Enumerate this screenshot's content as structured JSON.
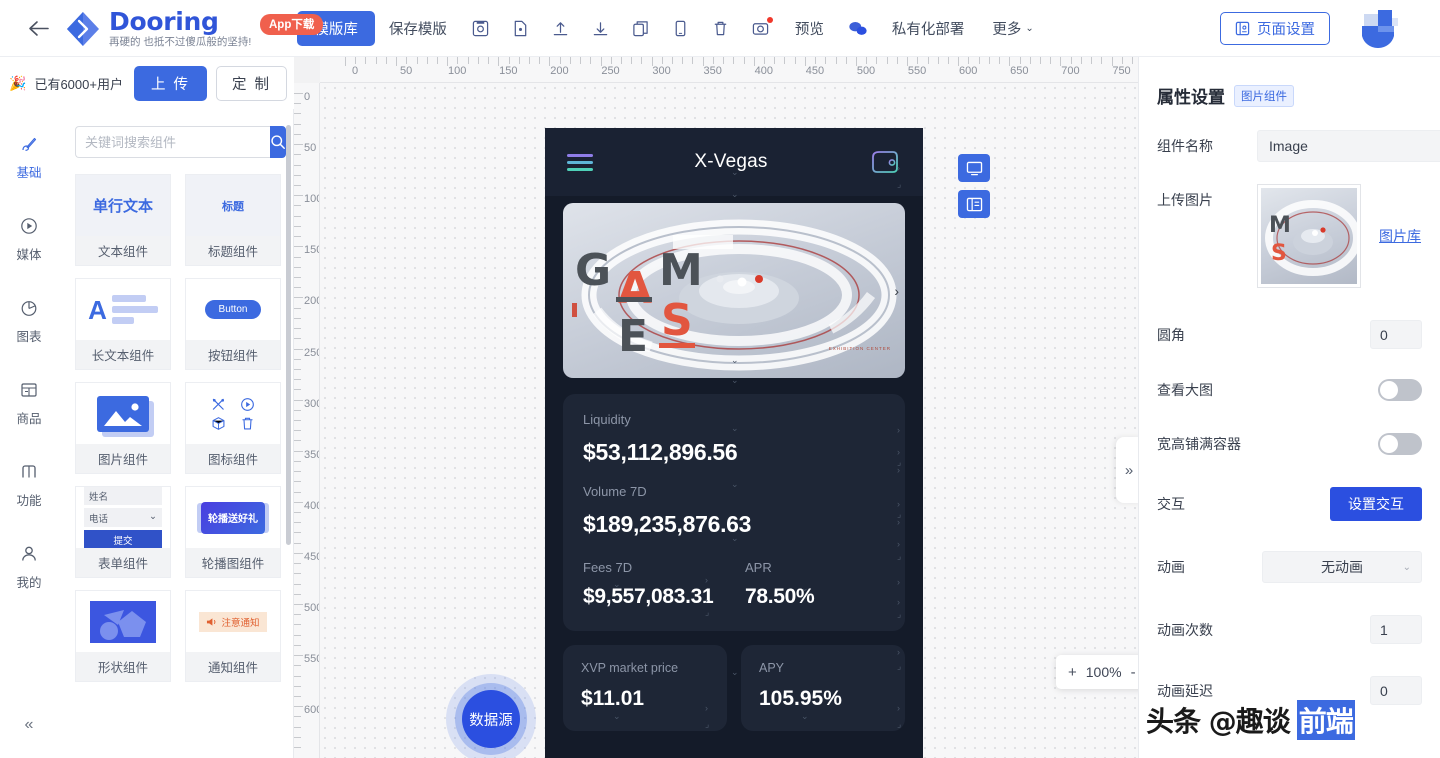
{
  "topbar": {
    "back_icon": "back-arrow-icon",
    "brand_name": "Dooring",
    "brand_slogan": "再硬的 也抵不过傻瓜般的坚持!",
    "app_badge": "App下载",
    "menu": [
      {
        "label": "模版库",
        "type": "text",
        "active": true
      },
      {
        "label": "保存模版",
        "type": "text",
        "active": false
      },
      {
        "label": "save-disk-icon",
        "type": "icon"
      },
      {
        "label": "file-icon",
        "type": "icon"
      },
      {
        "label": "upload-icon",
        "type": "icon"
      },
      {
        "label": "download-icon",
        "type": "icon"
      },
      {
        "label": "copy-icon",
        "type": "icon"
      },
      {
        "label": "mobile-icon",
        "type": "icon"
      },
      {
        "label": "trash-icon",
        "type": "icon"
      },
      {
        "label": "camera-icon",
        "type": "icon",
        "badge": true
      },
      {
        "label": "预览",
        "type": "text",
        "active": false
      },
      {
        "label": "wechat-icon",
        "type": "icon"
      },
      {
        "label": "私有化部署",
        "type": "text",
        "active": false
      },
      {
        "label": "更多",
        "type": "text",
        "active": false,
        "chevron": "⌄"
      }
    ],
    "page_setting": "页面设置",
    "page_setting_icon": "page-setting-icon",
    "avatar": "user-avatar-logo"
  },
  "left": {
    "promo_emoji": "🎉",
    "promo_text": "已有6000+用户",
    "upload_btn": "上 传",
    "custom_btn": "定 制",
    "rail": [
      {
        "label": "基础",
        "icon": "brush-icon",
        "active": true
      },
      {
        "label": "媒体",
        "icon": "play-circle-icon",
        "active": false
      },
      {
        "label": "图表",
        "icon": "pie-chart-icon",
        "active": false
      },
      {
        "label": "商品",
        "icon": "shop-icon",
        "active": false
      },
      {
        "label": "我的",
        "icon": "user-icon",
        "active": false
      }
    ],
    "rail_collapse_icon": "collapse-left-icon",
    "search_placeholder": "关键词搜索组件",
    "search_value": "",
    "search_icon": "search-icon",
    "components": [
      {
        "name": "文本组件",
        "thumb": "单行文本",
        "kind": "text"
      },
      {
        "name": "标题组件",
        "thumb": "标题",
        "kind": "title"
      },
      {
        "name": "长文本组件",
        "thumb": "A",
        "kind": "longtext"
      },
      {
        "name": "按钮组件",
        "thumb": "Button",
        "kind": "button"
      },
      {
        "name": "图片组件",
        "thumb": "image-icon",
        "kind": "image"
      },
      {
        "name": "图标组件",
        "thumb": "icon-set",
        "kind": "icons"
      },
      {
        "name": "表单组件",
        "thumb": "form",
        "kind": "form",
        "fields": [
          "姓名",
          "电话"
        ],
        "submit": "提交"
      },
      {
        "name": "轮播图组件",
        "thumb": "轮播送好礼",
        "kind": "carousel"
      },
      {
        "name": "形状组件",
        "thumb": "shape",
        "kind": "shape"
      },
      {
        "name": "通知组件",
        "thumb": "注意通知",
        "kind": "notice"
      }
    ]
  },
  "canvas": {
    "ruler_h_labels": [
      0,
      50,
      100,
      150,
      200,
      250,
      300,
      350,
      400,
      450,
      500,
      550,
      600,
      650,
      700,
      750
    ],
    "ruler_v_labels": [
      0,
      50,
      100,
      150,
      200,
      250,
      300,
      350,
      400,
      450,
      500,
      550,
      600
    ],
    "tools": [
      {
        "icon": "desktop-preview-icon",
        "name": "desktop-preview"
      },
      {
        "icon": "layout-panel-icon",
        "name": "layout-panel"
      }
    ],
    "datasource_btn": "数据源",
    "expand_tab_icon": "expand-right-icon",
    "zoombar": {
      "zoom_in": "+",
      "zoom_level": "100%",
      "zoom_out": "-",
      "grid_icon": "grid-icon",
      "fullscreen_icon": "fullscreen-icon"
    },
    "phone": {
      "header": {
        "menu_icon": "hamburger-menu-icon",
        "title": "X-Vegas",
        "wallet_icon": "wallet-icon"
      },
      "hero": {
        "letters": [
          "G",
          "A",
          "M",
          "E",
          "S"
        ],
        "caption": "EXHIBITION CENTER",
        "next_icon": "chevron-right-icon"
      },
      "stats": {
        "liquidity_label": "Liquidity",
        "liquidity_value": "$53,112,896.56",
        "volume_label": "Volume 7D",
        "volume_value": "$189,235,876.63",
        "fees_label": "Fees 7D",
        "fees_value": "$9,557,083.31",
        "apr_label": "APR",
        "apr_value": "78.50%"
      },
      "bottom": [
        {
          "label": "XVP market price",
          "value": "$11.01"
        },
        {
          "label": "APY",
          "value": "105.95%"
        }
      ]
    }
  },
  "props": {
    "title": "属性设置",
    "tag": "图片组件",
    "component_name_label": "组件名称",
    "component_name_value": "Image",
    "upload_label": "上传图片",
    "image_library_link": "图片库",
    "radius_label": "圆角",
    "radius_value": "0",
    "viewbig_label": "查看大图",
    "viewbig_on": false,
    "fill_label": "宽高铺满容器",
    "fill_on": false,
    "interaction_label": "交互",
    "interaction_btn": "设置交互",
    "animation_label": "动画",
    "animation_value": "无动画",
    "anim_count_label": "动画次数",
    "anim_count_value": "1",
    "anim_delay_label": "动画延迟",
    "anim_delay_value": "0"
  },
  "watermark": {
    "prefix": "头条 @趣谈",
    "highlight": "前端"
  },
  "colors": {
    "accent": "#3c6ae0",
    "accent_dark": "#2b4fe0",
    "badge_red": "#f0604d",
    "phone_bg": "#141b29",
    "card_bg": "#1e2636"
  }
}
